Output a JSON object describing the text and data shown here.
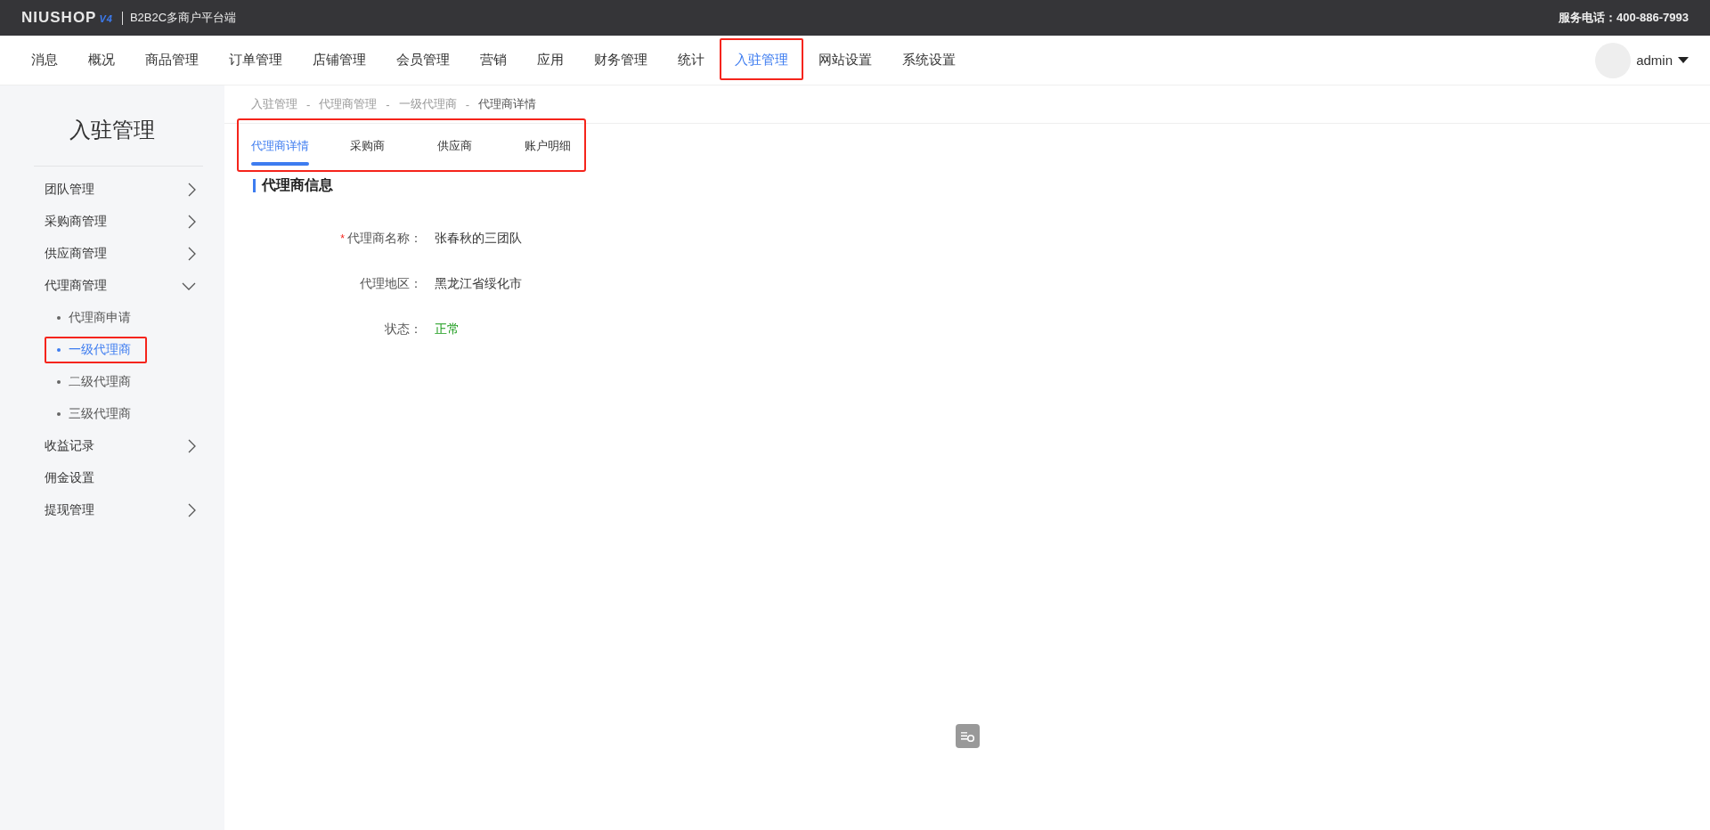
{
  "top_bar": {
    "logo": "NIUSHOP",
    "logo_version": "V4",
    "subtitle": "B2B2C多商户平台端",
    "service_phone": "服务电话：400-886-7993"
  },
  "nav": {
    "items": [
      {
        "label": "消息",
        "selected": false,
        "annotated": false
      },
      {
        "label": "概况",
        "selected": false,
        "annotated": false
      },
      {
        "label": "商品管理",
        "selected": false,
        "annotated": false
      },
      {
        "label": "订单管理",
        "selected": false,
        "annotated": false
      },
      {
        "label": "店铺管理",
        "selected": false,
        "annotated": false
      },
      {
        "label": "会员管理",
        "selected": false,
        "annotated": false
      },
      {
        "label": "营销",
        "selected": false,
        "annotated": false
      },
      {
        "label": "应用",
        "selected": false,
        "annotated": false
      },
      {
        "label": "财务管理",
        "selected": false,
        "annotated": false
      },
      {
        "label": "统计",
        "selected": false,
        "annotated": false
      },
      {
        "label": "入驻管理",
        "selected": true,
        "annotated": true
      },
      {
        "label": "网站设置",
        "selected": false,
        "annotated": false
      },
      {
        "label": "系统设置",
        "selected": false,
        "annotated": false
      }
    ],
    "user": {
      "name": "admin"
    }
  },
  "sidebar": {
    "title": "入驻管理",
    "items": [
      {
        "label": "团队管理",
        "kind": "group",
        "expanded": false
      },
      {
        "label": "采购商管理",
        "kind": "group",
        "expanded": false
      },
      {
        "label": "供应商管理",
        "kind": "group",
        "expanded": false
      },
      {
        "label": "代理商管理",
        "kind": "group",
        "expanded": true,
        "children": [
          {
            "label": "代理商申请",
            "selected": false,
            "annotated": false
          },
          {
            "label": "一级代理商",
            "selected": true,
            "annotated": true
          },
          {
            "label": "二级代理商",
            "selected": false,
            "annotated": false
          },
          {
            "label": "三级代理商",
            "selected": false,
            "annotated": false
          }
        ]
      },
      {
        "label": "收益记录",
        "kind": "group",
        "expanded": false
      },
      {
        "label": "佣金设置",
        "kind": "link"
      },
      {
        "label": "提现管理",
        "kind": "group",
        "expanded": false
      }
    ]
  },
  "breadcrumb": {
    "separator": "-",
    "items": [
      "入驻管理",
      "代理商管理",
      "一级代理商",
      "代理商详情"
    ]
  },
  "tabs": {
    "annotated": true,
    "items": [
      {
        "label": "代理商详情",
        "selected": true
      },
      {
        "label": "采购商",
        "selected": false
      },
      {
        "label": "供应商",
        "selected": false
      },
      {
        "label": "账户明细",
        "selected": false
      }
    ]
  },
  "section": {
    "title": "代理商信息",
    "required_mark": "*",
    "fields": [
      {
        "label": "代理商名称：",
        "required": true,
        "kind": "text",
        "value": "张春秋的三团队"
      },
      {
        "label": "代理地区：",
        "required": false,
        "kind": "text",
        "value": "黑龙江省绥化市"
      },
      {
        "label": "状态：",
        "required": false,
        "kind": "status",
        "value": "正常"
      }
    ]
  }
}
